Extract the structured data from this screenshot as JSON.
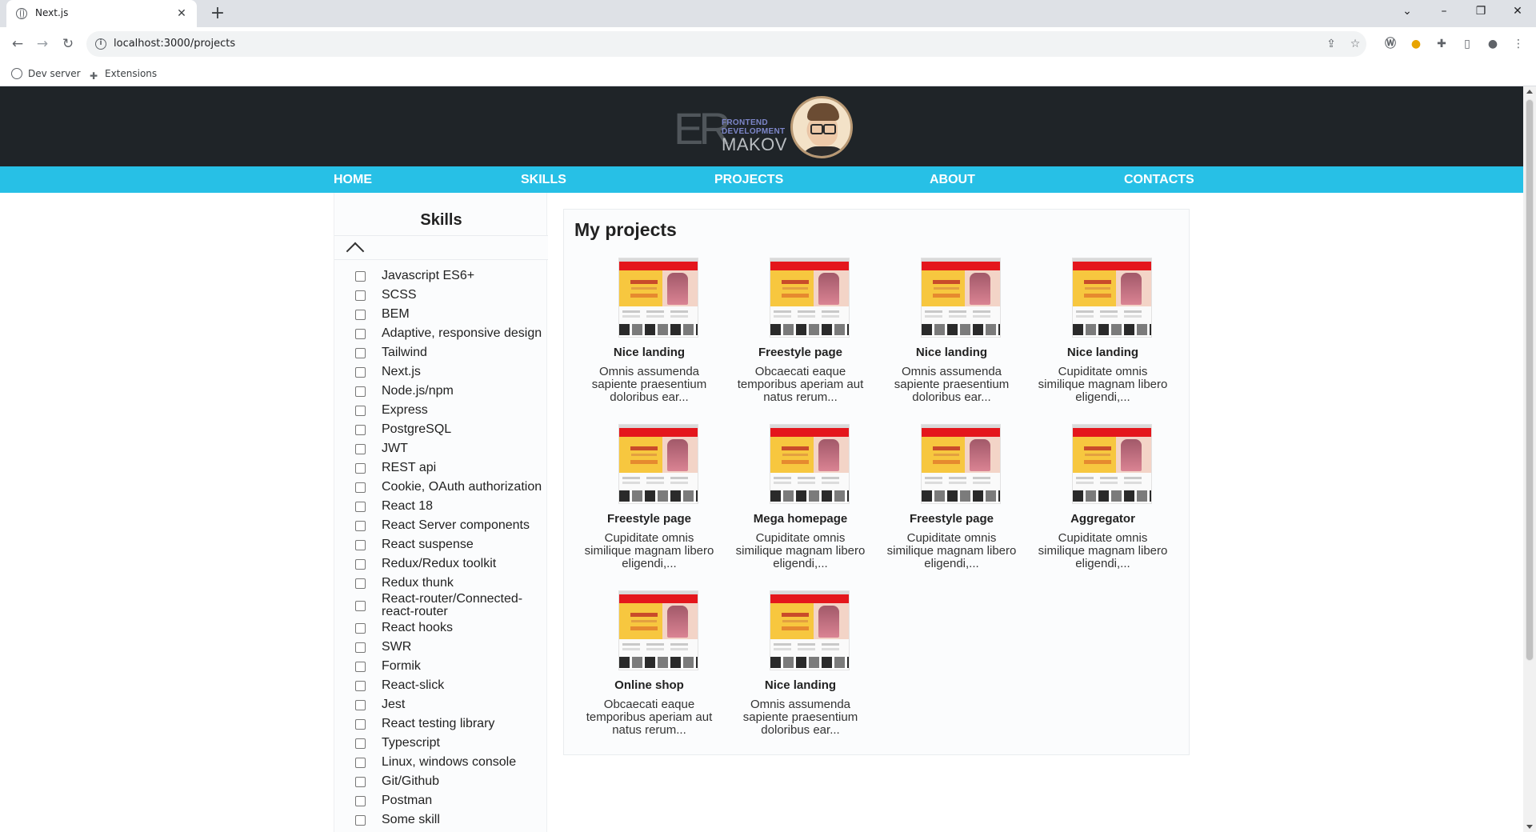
{
  "browser": {
    "tab_title": "Next.js",
    "new_tab": "+",
    "url": "localhost:3000/projects",
    "bookmarks": [
      {
        "label": "Dev server"
      },
      {
        "label": "Extensions"
      }
    ]
  },
  "site": {
    "logo": {
      "initials": "ER",
      "tagline_1": "FRONTEND",
      "tagline_2": "DEVELOPMENT",
      "name": "MAKOV"
    },
    "nav": [
      "HOME",
      "SKILLS",
      "PROJECTS",
      "ABOUT",
      "CONTACTS"
    ],
    "colors": {
      "header_bg": "#1f2428",
      "nav_bg": "#27c0e6",
      "nav_text": "#ffffff"
    }
  },
  "sidebar": {
    "title": "Skills",
    "skills": [
      "Javascript ES6+",
      "SCSS",
      "BEM",
      "Adaptive, responsive design",
      "Tailwind",
      "Next.js",
      "Node.js/npm",
      "Express",
      "PostgreSQL",
      "JWT",
      "REST api",
      "Cookie, OAuth authorization",
      "React 18",
      "React Server components",
      "React suspense",
      "Redux/Redux toolkit",
      "Redux thunk",
      "React-router/Connected-react-router",
      "React hooks",
      "SWR",
      "Formik",
      "React-slick",
      "Jest",
      "React testing library",
      "Typescript",
      "Linux, windows console",
      "Git/Github",
      "Postman",
      "Some skill"
    ]
  },
  "projects": {
    "title": "My projects",
    "items": [
      {
        "title": "Nice landing",
        "desc": "Omnis assumenda sapiente praesentium doloribus ear..."
      },
      {
        "title": "Freestyle page",
        "desc": "Obcaecati eaque temporibus aperiam aut natus rerum..."
      },
      {
        "title": "Nice landing",
        "desc": "Omnis assumenda sapiente praesentium doloribus ear..."
      },
      {
        "title": "Nice landing",
        "desc": "Cupiditate omnis similique magnam libero eligendi,..."
      },
      {
        "title": "Freestyle page",
        "desc": "Cupiditate omnis similique magnam libero eligendi,..."
      },
      {
        "title": "Mega homepage",
        "desc": "Cupiditate omnis similique magnam libero eligendi,..."
      },
      {
        "title": "Freestyle page",
        "desc": "Cupiditate omnis similique magnam libero eligendi,..."
      },
      {
        "title": "Aggregator",
        "desc": "Cupiditate omnis similique magnam libero eligendi,..."
      },
      {
        "title": "Online shop",
        "desc": "Obcaecati eaque temporibus aperiam aut natus rerum..."
      },
      {
        "title": "Nice landing",
        "desc": "Omnis assumenda sapiente praesentium doloribus ear..."
      }
    ]
  }
}
